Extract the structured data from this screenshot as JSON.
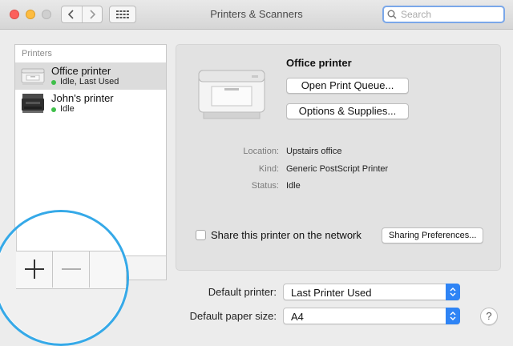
{
  "window": {
    "title": "Printers & Scanners",
    "search_placeholder": "Search"
  },
  "printers_list": {
    "header": "Printers",
    "items": [
      {
        "name": "Office printer",
        "status": "Idle, Last Used",
        "selected": true,
        "icon": "laser-printer-icon"
      },
      {
        "name": "John's printer",
        "status": "Idle",
        "selected": false,
        "icon": "multifunction-printer-icon"
      }
    ],
    "add_button_icon": "plus-icon",
    "remove_button_icon": "minus-icon"
  },
  "detail": {
    "printer_name": "Office printer",
    "open_queue_label": "Open Print Queue...",
    "options_label": "Options & Supplies...",
    "location_label": "Location:",
    "location_value": "Upstairs office",
    "kind_label": "Kind:",
    "kind_value": "Generic PostScript Printer",
    "status_label": "Status:",
    "status_value": "Idle",
    "share_label": "Share this printer on the network",
    "share_checked": false,
    "sharing_prefs_label": "Sharing Preferences..."
  },
  "defaults": {
    "default_printer_label": "Default printer:",
    "default_printer_value": "Last Printer Used",
    "paper_size_label": "Default paper size:",
    "paper_size_value": "A4"
  },
  "help_label": "?",
  "colors": {
    "accent": "#2f84f5",
    "status_dot": "#3fbf4a",
    "magnifier_ring": "#35a9e8"
  }
}
